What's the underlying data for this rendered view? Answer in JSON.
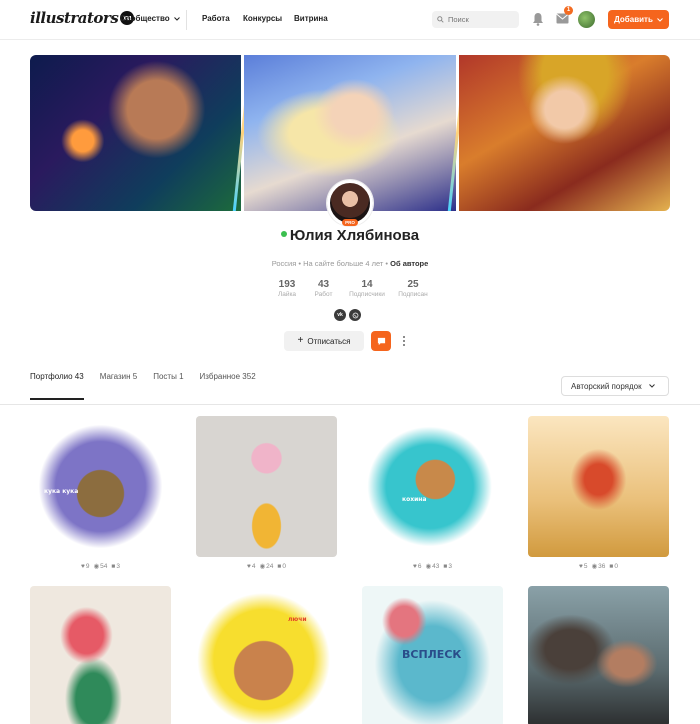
{
  "header": {
    "logo_text": "illustrators",
    "logo_badge": "ru",
    "nav": {
      "community": "Сообщество",
      "work": "Работа",
      "contests": "Конкурсы",
      "showcase": "Витрина"
    },
    "search_placeholder": "Поиск",
    "mail_badge": "1",
    "add_button": "Добавить"
  },
  "profile": {
    "name": "Юлия Хлябинова",
    "pro_label": "PRO",
    "country": "Россия",
    "sep": " • ",
    "tenure": "На сайте больше 4 лет",
    "about_link": "Об авторе",
    "stats": [
      {
        "value": "193",
        "label": "Лайка"
      },
      {
        "value": "43",
        "label": "Работ"
      },
      {
        "value": "14",
        "label": "Подписчики"
      },
      {
        "value": "25",
        "label": "Подписан"
      }
    ],
    "socials": [
      "vk-icon",
      "whatsapp-icon"
    ],
    "unsubscribe_button": "Отписаться"
  },
  "tabs": [
    {
      "label": "Портфолио 43",
      "active": true
    },
    {
      "label": "Магазин 5",
      "active": false
    },
    {
      "label": "Посты 1",
      "active": false
    },
    {
      "label": "Избранное 352",
      "active": false
    }
  ],
  "sort": {
    "selected": "Авторский порядок"
  },
  "works": [
    {
      "likes": "9",
      "views": "54",
      "comments": "3",
      "caption": "кука кука"
    },
    {
      "likes": "4",
      "views": "24",
      "comments": "0",
      "caption": ""
    },
    {
      "likes": "6",
      "views": "43",
      "comments": "3",
      "caption": "кохина"
    },
    {
      "likes": "5",
      "views": "36",
      "comments": "0",
      "caption": ""
    },
    {
      "likes": "",
      "views": "",
      "comments": "",
      "caption": ""
    },
    {
      "likes": "",
      "views": "",
      "comments": "",
      "caption": "лючи"
    },
    {
      "likes": "",
      "views": "",
      "comments": "",
      "caption": "ВСПЛЕСК"
    },
    {
      "likes": "",
      "views": "",
      "comments": "",
      "caption": ""
    }
  ],
  "colors": {
    "accent": "#f5651d",
    "online": "#3bbf4f"
  }
}
